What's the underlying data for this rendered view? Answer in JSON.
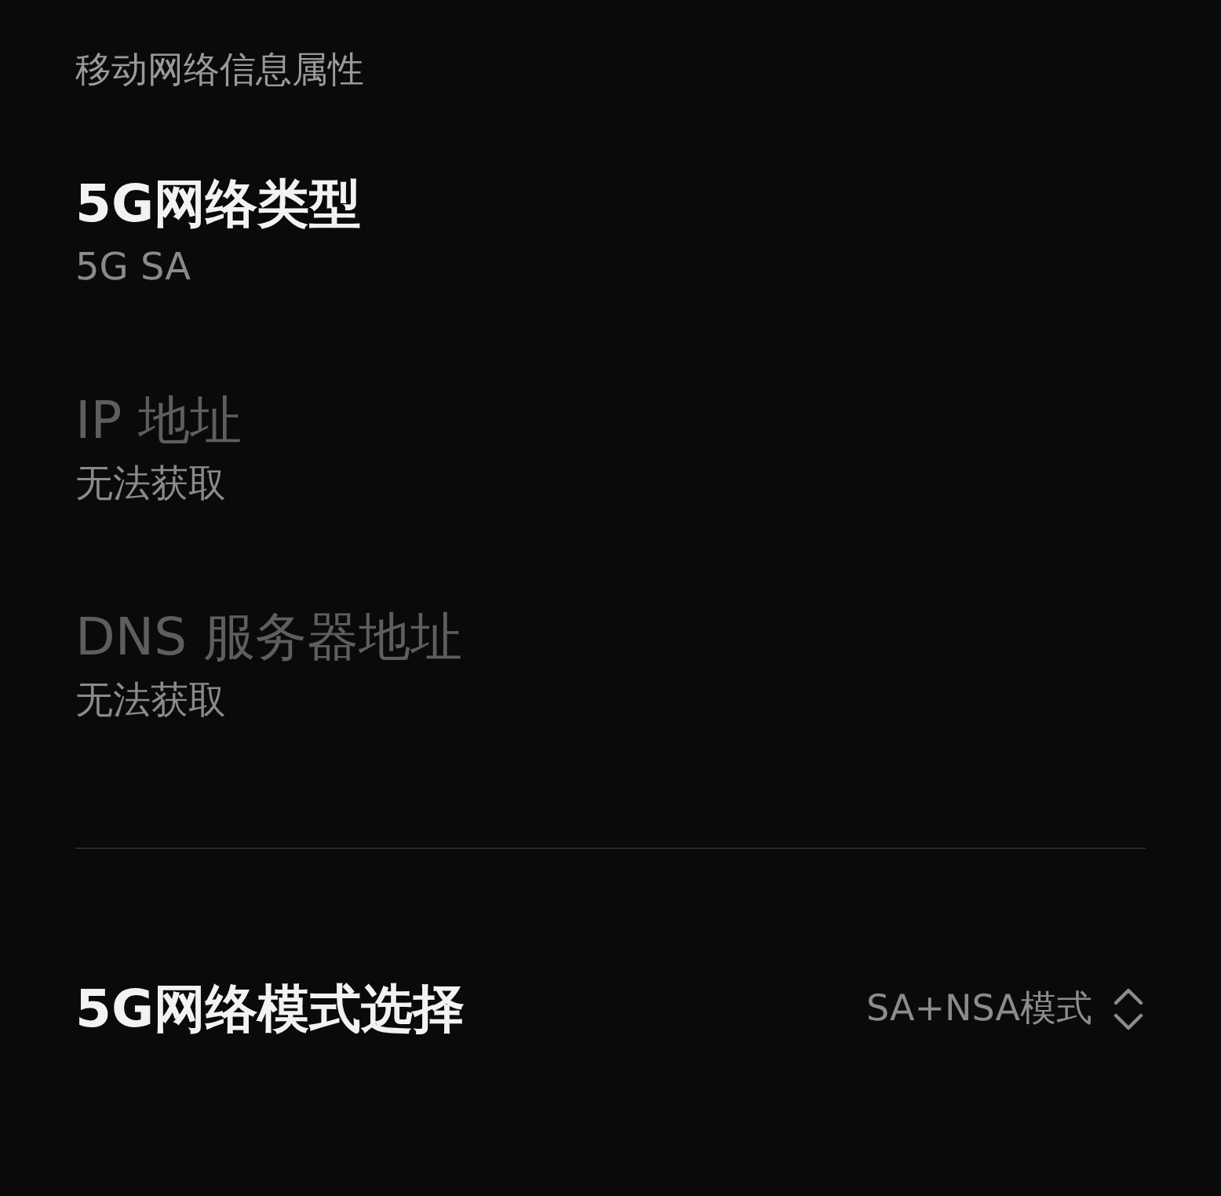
{
  "section_header": "移动网络信息属性",
  "items": [
    {
      "title": "5G网络类型",
      "value": "5G SA",
      "disabled": false
    },
    {
      "title": "IP 地址",
      "value": "无法获取",
      "disabled": true
    },
    {
      "title": "DNS 服务器地址",
      "value": "无法获取",
      "disabled": true
    }
  ],
  "mode_row": {
    "title": "5G网络模式选择",
    "value": "SA+NSA模式"
  }
}
